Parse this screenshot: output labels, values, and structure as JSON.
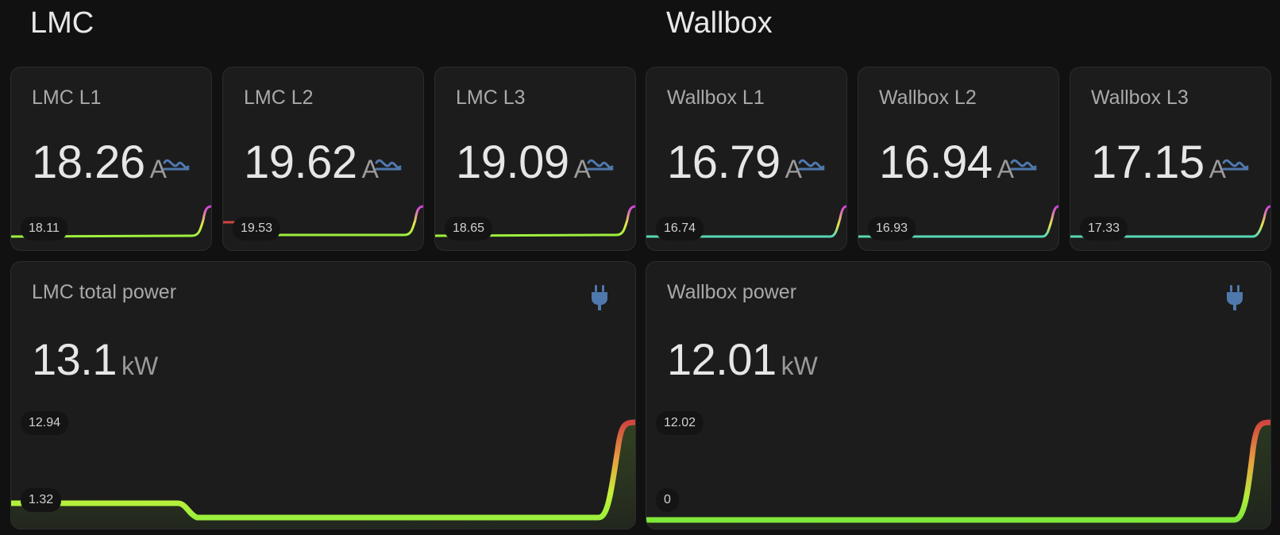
{
  "sections": {
    "lmc": {
      "title": "LMC"
    },
    "wallbox": {
      "title": "Wallbox"
    }
  },
  "cards": [
    {
      "name": "LMC L1",
      "value": "18.26",
      "unit": "A",
      "min_label": "18.11",
      "icon": "sine-wave-icon"
    },
    {
      "name": "LMC L2",
      "value": "19.62",
      "unit": "A",
      "min_label": "19.53",
      "icon": "sine-wave-icon"
    },
    {
      "name": "LMC L3",
      "value": "19.09",
      "unit": "A",
      "min_label": "18.65",
      "icon": "sine-wave-icon"
    },
    {
      "name": "Wallbox L1",
      "value": "16.79",
      "unit": "A",
      "min_label": "16.74",
      "icon": "sine-wave-icon"
    },
    {
      "name": "Wallbox L2",
      "value": "16.94",
      "unit": "A",
      "min_label": "16.93",
      "icon": "sine-wave-icon"
    },
    {
      "name": "Wallbox L3",
      "value": "17.15",
      "unit": "A",
      "min_label": "17.33",
      "icon": "sine-wave-icon"
    }
  ],
  "power": [
    {
      "name": "LMC total power",
      "value": "13.1",
      "unit": "kW",
      "max_label": "12.94",
      "min_label": "1.32",
      "icon": "power-plug-icon"
    },
    {
      "name": "Wallbox power",
      "value": "12.01",
      "unit": "kW",
      "max_label": "12.02",
      "min_label": "0",
      "icon": "power-plug-icon"
    }
  ],
  "colors": {
    "background": "#111111",
    "card": "#1c1c1c",
    "icon": "#4f78ad",
    "spark_green": "#9cf03c",
    "spark_teal": "#55d8b8",
    "spark_yellow": "#e8e84a",
    "spark_red": "#d0453f",
    "spark_magenta": "#d23ce0"
  }
}
